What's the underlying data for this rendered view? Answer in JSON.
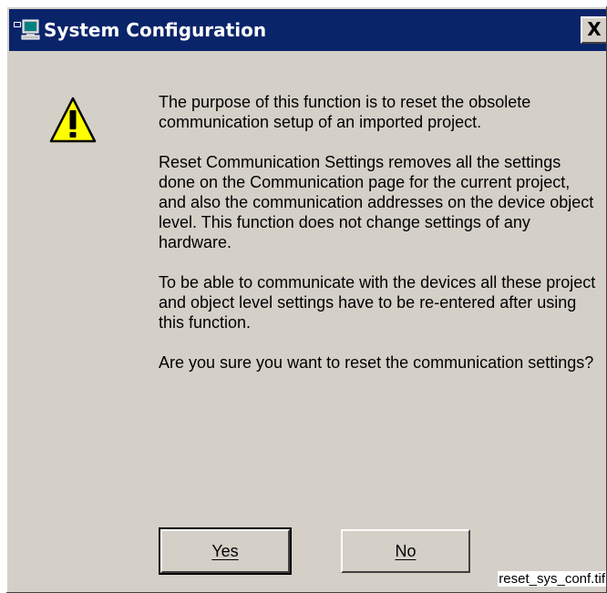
{
  "window": {
    "title": "System Configuration",
    "close_label": "X",
    "title_icon": "system-configuration-icon"
  },
  "dialog": {
    "icon": "warning-icon",
    "paragraphs": [
      "The purpose of this function is to reset the obsolete communication setup of an imported project.",
      "Reset Communication Settings removes all the settings done on the Communication page for the current project, and also the communication addresses on the device object level. This function does not change settings of any hardware.",
      "To be able to communicate with the devices all these project and object level settings have to be re-entered after using this function.",
      "Are you sure you want to reset the communication settings?"
    ],
    "buttons": {
      "yes_label": "Yes",
      "no_label": "No"
    }
  },
  "caption": "reset_sys_conf.tif",
  "colors": {
    "titlebar": "#0a246a",
    "face": "#d4d0c8",
    "warning": "#ffff00"
  }
}
